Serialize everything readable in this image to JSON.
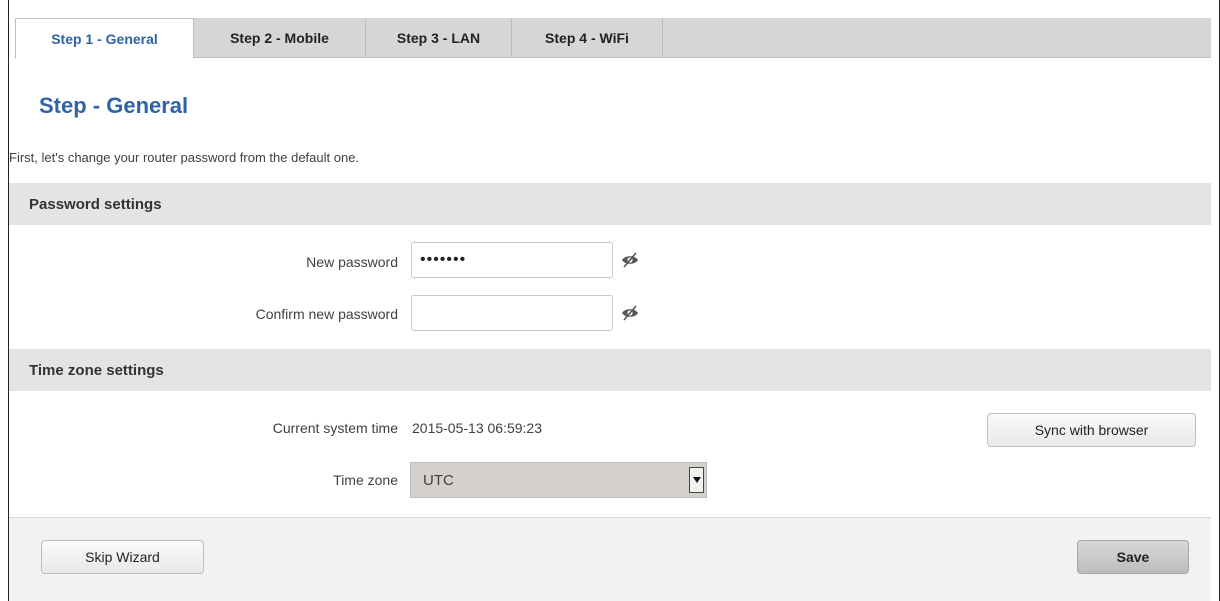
{
  "tabs": [
    {
      "label": "Step 1 - General",
      "active": true
    },
    {
      "label": "Step 2 - Mobile",
      "active": false
    },
    {
      "label": "Step 3 - LAN",
      "active": false
    },
    {
      "label": "Step 4 - WiFi",
      "active": false
    }
  ],
  "page": {
    "title": "Step - General",
    "intro": "First, let's change your router password from the default one."
  },
  "password_section": {
    "header": "Password settings",
    "new_password_label": "New password",
    "new_password_value": "•••••••",
    "confirm_password_label": "Confirm new password",
    "confirm_password_value": ""
  },
  "timezone_section": {
    "header": "Time zone settings",
    "current_time_label": "Current system time",
    "current_time_value": "2015-05-13 06:59:23",
    "sync_button": "Sync with browser",
    "timezone_label": "Time zone",
    "timezone_value": "UTC"
  },
  "footer": {
    "skip_button": "Skip Wizard",
    "save_button": "Save"
  },
  "colors": {
    "accent": "#2f63a6",
    "section_bg": "#e4e4e4",
    "tabbar_bg": "#d6d6d6"
  },
  "icons": {
    "password_toggle": "eye-slash-icon",
    "select_arrow": "triangle-down-icon"
  }
}
